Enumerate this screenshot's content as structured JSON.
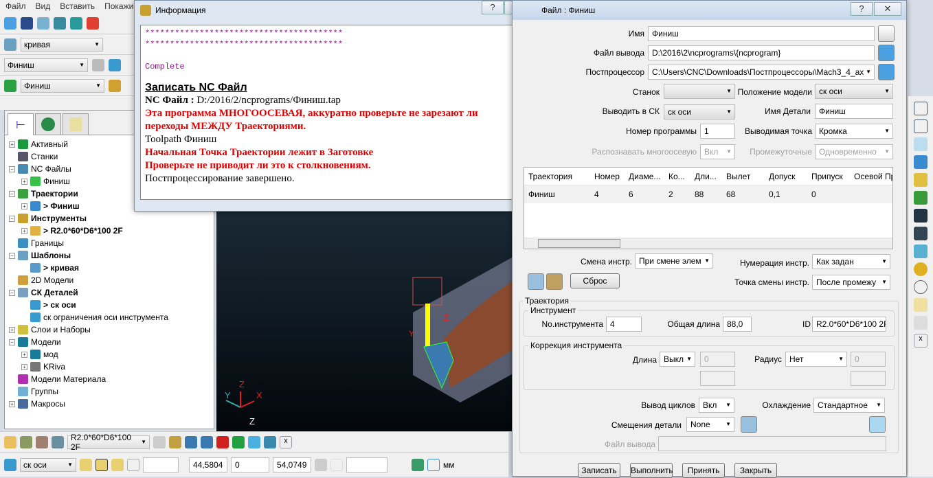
{
  "menu": [
    "Файл",
    "Вид",
    "Вставить",
    "Покажи"
  ],
  "toolbar": {
    "pattern_combo": "кривая",
    "nc_combo": "Финиш",
    "toolpath_combo": "Финиш"
  },
  "tree": {
    "items": [
      {
        "label": "Активный",
        "bold": false,
        "level": 0,
        "expand": "+",
        "icon": "active-icon",
        "color": "#1a9a3a"
      },
      {
        "label": "Станки",
        "bold": false,
        "level": 0,
        "expand": "",
        "icon": "machine-icon",
        "color": "#556"
      },
      {
        "label": "NC Файлы",
        "bold": false,
        "level": 0,
        "expand": "−",
        "icon": "nc-files-icon",
        "color": "#4a8ab0"
      },
      {
        "label": "Финиш",
        "bold": false,
        "level": 1,
        "expand": "+",
        "icon": "nc-program-icon",
        "color": "#3ac04a"
      },
      {
        "label": "Траектории",
        "bold": true,
        "level": 0,
        "expand": "−",
        "icon": "toolpaths-icon",
        "color": "#3aa040"
      },
      {
        "label": "> Финиш",
        "bold": true,
        "level": 1,
        "expand": "+",
        "icon": "toolpath-icon",
        "color": "#3a8ad0"
      },
      {
        "label": "Инструменты",
        "bold": true,
        "level": 0,
        "expand": "−",
        "icon": "tools-icon",
        "color": "#c8a030"
      },
      {
        "label": "> R2.0*60*D6*100 2F",
        "bold": true,
        "level": 1,
        "expand": "+",
        "icon": "tool-icon",
        "color": "#e0b040"
      },
      {
        "label": "Границы",
        "bold": false,
        "level": 0,
        "expand": "",
        "icon": "boundary-icon",
        "color": "#3a90c0"
      },
      {
        "label": "Шаблоны",
        "bold": true,
        "level": 0,
        "expand": "−",
        "icon": "patterns-icon",
        "color": "#6aa0c0"
      },
      {
        "label": "> кривая",
        "bold": true,
        "level": 1,
        "expand": "",
        "icon": "pattern-icon",
        "color": "#5a9ac8"
      },
      {
        "label": "2D Модели",
        "bold": false,
        "level": 0,
        "expand": "",
        "icon": "2d-model-icon",
        "color": "#d0a040"
      },
      {
        "label": "СК Деталей",
        "bold": true,
        "level": 0,
        "expand": "−",
        "icon": "workplanes-icon",
        "color": "#7aa0c0"
      },
      {
        "label": "> ск оси",
        "bold": true,
        "level": 1,
        "expand": "",
        "icon": "workplane-icon",
        "color": "#3a9ad0"
      },
      {
        "label": "ск ограничения оси инструмента",
        "bold": false,
        "level": 1,
        "expand": "",
        "icon": "workplane-icon",
        "color": "#3a9ad0"
      },
      {
        "label": "Слои и Наборы",
        "bold": false,
        "level": 0,
        "expand": "+",
        "icon": "layers-icon",
        "color": "#d0c040"
      },
      {
        "label": "Модели",
        "bold": false,
        "level": 0,
        "expand": "−",
        "icon": "models-icon",
        "color": "#1a7a9a"
      },
      {
        "label": "мод",
        "bold": false,
        "level": 1,
        "expand": "+",
        "icon": "model-icon",
        "color": "#1a7a9a"
      },
      {
        "label": "KRiva",
        "bold": false,
        "level": 1,
        "expand": "+",
        "icon": "model-icon",
        "color": "#777"
      },
      {
        "label": "Модели Материала",
        "bold": false,
        "level": 0,
        "expand": "",
        "icon": "stock-models-icon",
        "color": "#b030b0"
      },
      {
        "label": "Группы",
        "bold": false,
        "level": 0,
        "expand": "",
        "icon": "groups-icon",
        "color": "#70b0d0"
      },
      {
        "label": "Макросы",
        "bold": false,
        "level": 0,
        "expand": "+",
        "icon": "macros-icon",
        "color": "#4a6a9a"
      }
    ]
  },
  "viewport": {
    "axis_z": "Z",
    "axis_y": "Y",
    "axis_x": "X",
    "view_z": "Z"
  },
  "info": {
    "title": "Информация",
    "help": "?",
    "close": "✕",
    "stars1": "****************************************",
    "stars2": "****************************************",
    "complete": "Complete",
    "heading": "Записать NC Файл",
    "nc_label": "NC Файл :",
    "nc_path": " D:/2016/2/ncprograms/Финиш.tap",
    "warn1": "Эта программа МНОГООСЕВАЯ, аккуратно проверьте не зарезают ли переходы МЕЖДУ Траекториями.",
    "toolpath": "Toolpath Финиш",
    "warn2": "Начальная Точка Траектории лежит в Заготовке",
    "warn3": "Проверьте не приводит ли это к столкновениям.",
    "done": "Постпроцессирование завершено."
  },
  "nc": {
    "title": "Файл : Финиш",
    "help": "?",
    "close": "✕",
    "name_label": "Имя",
    "name": "Финиш",
    "output_label": "Файл вывода",
    "output": "D:\\2016\\2\\ncprograms\\{ncprogram}",
    "post_label": "Постпроцессор",
    "post": "C:\\Users\\CNC\\Downloads\\Постпроцессоры\\Mach3_4_ax",
    "machine_label": "Станок",
    "machine": "",
    "model_pos_label": "Положение модели",
    "model_pos": "ск оси",
    "output_wp_label": "Выводить в СК",
    "output_wp": "ск оси",
    "part_name_label": "Имя Детали",
    "part_name": "Финиш",
    "prog_num_label": "Номер программы",
    "prog_num": "1",
    "output_point_label": "Выводимая точка",
    "output_point": "Кромка",
    "multiaxis_label": "Распознавать многоосевую",
    "multiaxis": "Вкл",
    "intermediate_label": "Промежуточные",
    "intermediate": "Одновременно",
    "table": {
      "headers": [
        "Траектория",
        "Номер",
        "Диаме...",
        "Ко...",
        "Дли...",
        "Вылет",
        "Допуск",
        "Припуск",
        "Осевой Пр"
      ],
      "rows": [
        [
          "Финиш",
          "4",
          "6",
          "2",
          "88",
          "68",
          "0,1",
          "0",
          ""
        ]
      ]
    },
    "tool_change_label": "Смена инстр.",
    "tool_change": "При смене элем",
    "tool_numbering_label": "Нумерация инстр.",
    "tool_numbering": "Как задан",
    "reset": "Сброс",
    "tool_change_point_label": "Точка смены инстр.",
    "tool_change_point": "После промежу",
    "toolpath_group": "Траектория",
    "tool_group": "Инструмент",
    "tool_no_label": "No.инструмента",
    "tool_no": "4",
    "total_len_label": "Общая длина",
    "total_len": "88,0",
    "id_label": "ID",
    "id": "R2.0*60*D6*100 2F",
    "comp_group": "Коррекция инструмента",
    "len_label": "Длина",
    "len": "Выкл",
    "len_val": "0",
    "radius_label": "Радиус",
    "radius": "Нет",
    "radius_val": "0",
    "cycles_label": "Вывод циклов",
    "cycles": "Вкл",
    "coolant_label": "Охлаждение",
    "coolant": "Стандартное",
    "offsets_label": "Смещения детали",
    "offsets": "None",
    "out_file_label": "Файл вывода",
    "out_file": "",
    "buttons": [
      "Записать",
      "Выполнить",
      "Принять",
      "Закрыть"
    ]
  },
  "bottom": {
    "tool_combo": "R2.0*60*D6*100 2F",
    "wp_combo": "ск оси",
    "x": "44,5804",
    "y": "0",
    "z": "54,0749",
    "units": "мм"
  }
}
